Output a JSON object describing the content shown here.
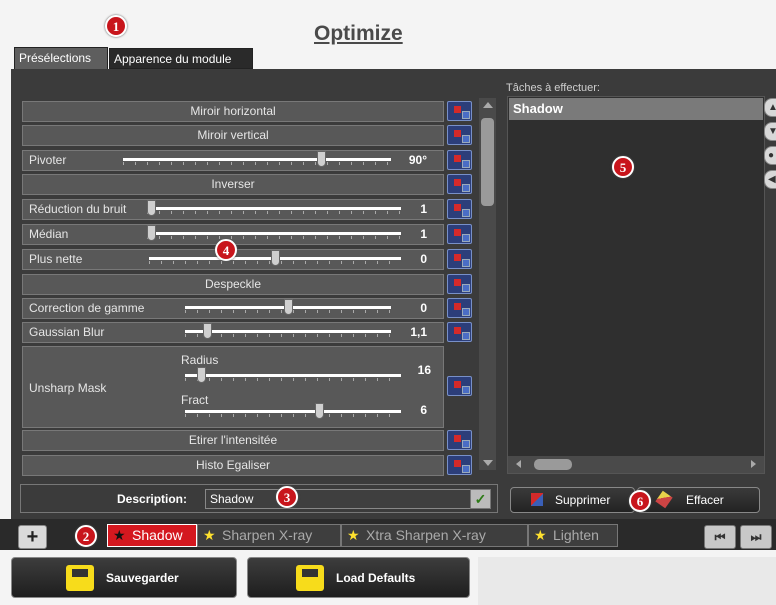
{
  "title": "Optimize",
  "markers": [
    "1",
    "2",
    "3",
    "4",
    "5",
    "6"
  ],
  "tabs": [
    {
      "label": "Présélections"
    },
    {
      "label": "Apparence du module"
    }
  ],
  "filters": {
    "miroir_h": "Miroir horizontal",
    "miroir_v": "Miroir vertical",
    "pivoter": {
      "label": "Pivoter",
      "value": "90°"
    },
    "inverser": "Inverser",
    "reduction": {
      "label": "Réduction du bruit",
      "value": "1"
    },
    "median": {
      "label": "Médian",
      "value": "1"
    },
    "nette": {
      "label": "Plus nette",
      "value": "0"
    },
    "despeckle": "Despeckle",
    "gamme": {
      "label": "Correction de gamme",
      "value": "0"
    },
    "gaussian": {
      "label": "Gaussian Blur",
      "value": "1,1"
    },
    "unsharp": {
      "label": "Unsharp Mask",
      "radius_label": "Radius",
      "radius_value": "16",
      "fract_label": "Fract",
      "fract_value": "6"
    },
    "etirer": "Etirer l'intensitée",
    "histo": "Histo Egaliser"
  },
  "slider_levels": {
    "pivoter": 0.75,
    "reduction": 0.0,
    "median": 0.0,
    "nette": 0.5,
    "gamme": 0.5,
    "gaussian": 0.09,
    "radius": 0.06,
    "fract": 0.63
  },
  "tasks": {
    "label": "Tâches à effectuer:",
    "items": [
      "Shadow"
    ]
  },
  "description": {
    "label": "Description:",
    "value": "Shadow"
  },
  "actions": {
    "delete": "Supprimer",
    "clear": "Effacer"
  },
  "presets": [
    {
      "label": "Shadow",
      "active": true
    },
    {
      "label": "Sharpen X-ray"
    },
    {
      "label": "Xtra Sharpen X-ray"
    },
    {
      "label": "Lighten"
    }
  ],
  "add_preset": "+",
  "nav": {
    "first": "⏮",
    "last": "⏭"
  },
  "buttons": {
    "save": "Sauvegarder",
    "load": "Load Defaults"
  },
  "colors": {
    "accent_red": "#d4181f",
    "star_yellow": "#ffe12e",
    "panel": "#3b3b3b",
    "icon_yellow": "#f7dc1b"
  }
}
